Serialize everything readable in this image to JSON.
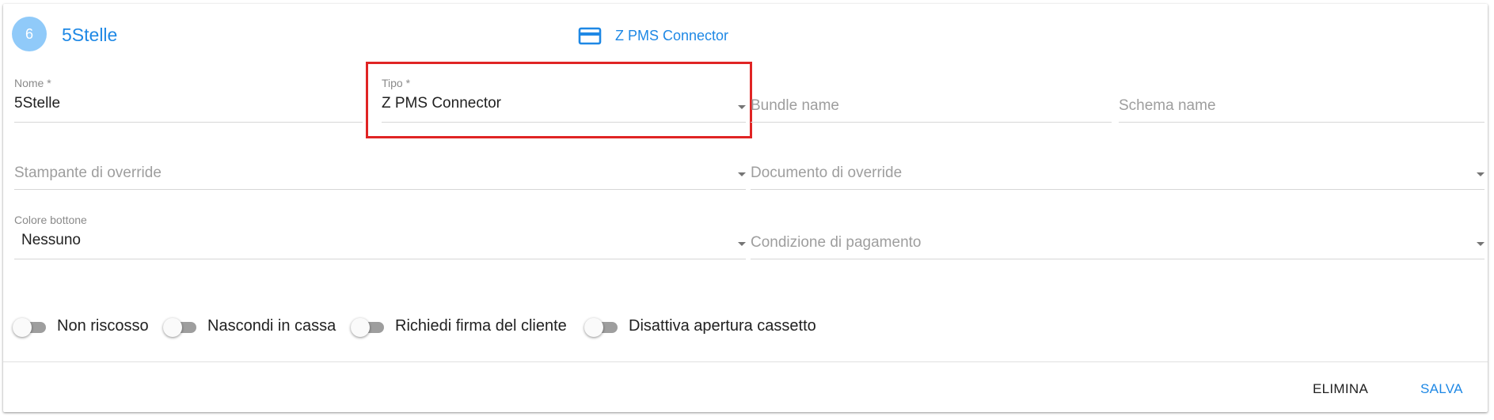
{
  "header": {
    "avatar_number": "6",
    "title": "5Stelle",
    "type_icon": "credit-card-icon",
    "type_label": "Z PMS Connector"
  },
  "form": {
    "nome": {
      "label": "Nome *",
      "value": "5Stelle"
    },
    "tipo": {
      "label": "Tipo *",
      "value": "Z PMS Connector"
    },
    "bundle_name": {
      "placeholder": "Bundle name"
    },
    "schema_name": {
      "placeholder": "Schema name"
    },
    "stampante_override": {
      "placeholder": "Stampante di override"
    },
    "documento_override": {
      "placeholder": "Documento di override"
    },
    "colore_bottone": {
      "label": "Colore bottone",
      "value": "Nessuno"
    },
    "condizione_pagamento": {
      "placeholder": "Condizione di pagamento"
    }
  },
  "toggles": [
    {
      "label": "Non riscosso",
      "checked": false
    },
    {
      "label": "Nascondi in cassa",
      "checked": false
    },
    {
      "label": "Richiedi firma del cliente",
      "checked": false
    },
    {
      "label": "Disattiva apertura cassetto",
      "checked": false
    }
  ],
  "actions": {
    "delete_label": "ELIMINA",
    "save_label": "SALVA"
  },
  "colors": {
    "accent": "#1e88e5",
    "avatar": "#90caf9",
    "highlight": "#e02424"
  }
}
